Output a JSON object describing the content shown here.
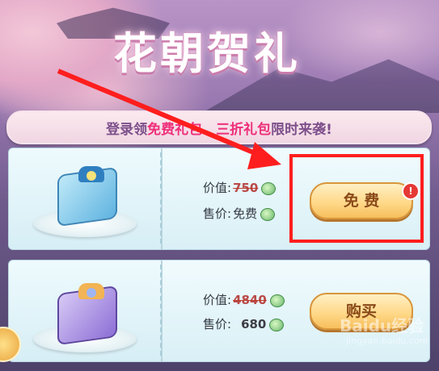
{
  "header": {
    "title": "花朝贺礼"
  },
  "banner": {
    "prefix": "登录领",
    "free_gift": "免费礼包",
    "separator": "、",
    "discount_gift": "三折礼包",
    "suffix": "限时来袭!"
  },
  "offers": [
    {
      "name": "free-gift-pack",
      "value_label": "价值:",
      "value_amount": "750",
      "price_label": "售价:",
      "price_amount": "免费",
      "button_label": "免 费",
      "badge": "!",
      "icon": "blue-gift-box-icon"
    },
    {
      "name": "discount-gift-pack",
      "value_label": "价值:",
      "value_amount": "4840",
      "price_label": "售价:",
      "price_amount": "680",
      "button_label": "购买",
      "icon": "purple-gift-box-icon"
    }
  ],
  "currency_icon": "jade-coin-icon",
  "watermark": {
    "text": "Baidu经验",
    "sub": "jingyan.baidu.com"
  },
  "colors": {
    "highlight": "#ff1e1e",
    "accent_pink": "#ee2f7a",
    "button_gold": "#ffd98a"
  }
}
